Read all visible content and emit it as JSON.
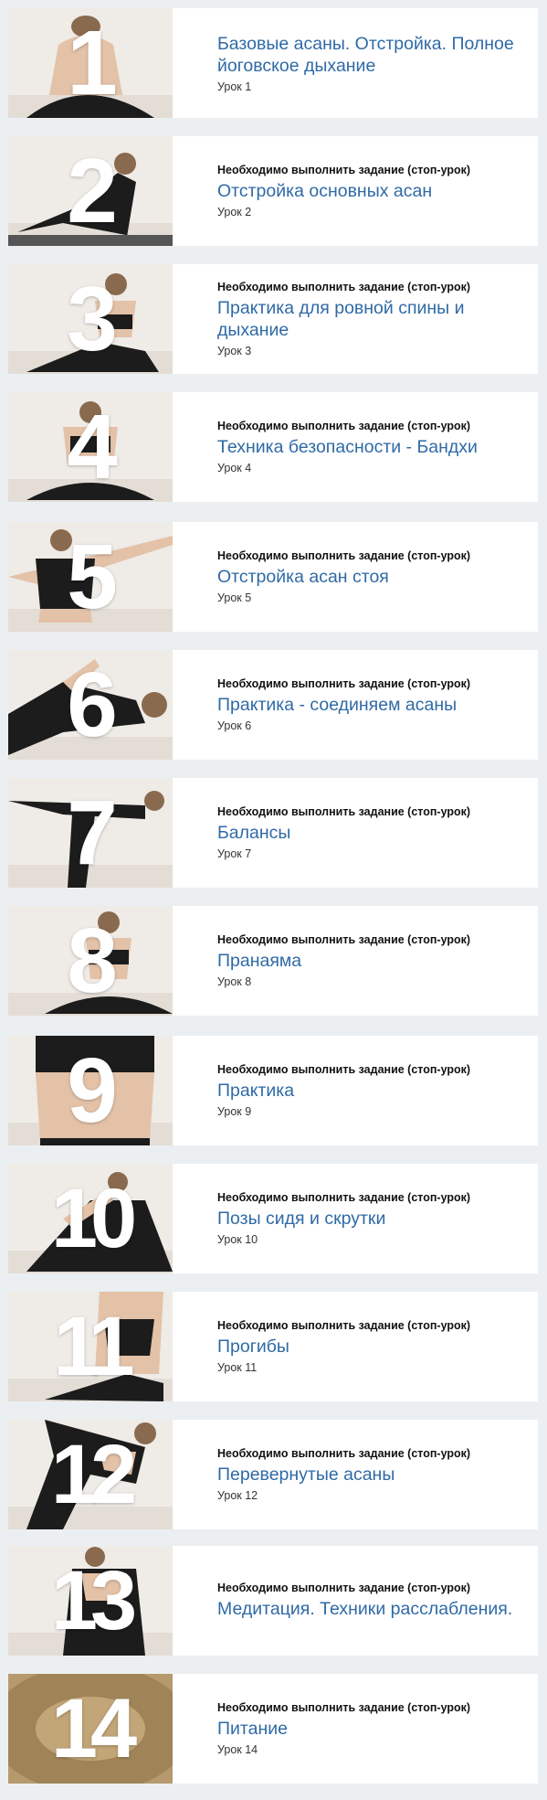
{
  "colors": {
    "page_bg": "#eceff1",
    "card_bg": "#ffffff",
    "title": "#2f6aa6",
    "notice": "#111111",
    "number": "#ffffff"
  },
  "lessons": [
    {
      "number": "1",
      "notice": "",
      "title": "Базовые асаны. Отстройка. Полное йоговское дыхание",
      "subtitle": "Урок 1"
    },
    {
      "number": "2",
      "notice": "Необходимо выполнить задание (стоп-урок)",
      "title": "Отстройка основных асан",
      "subtitle": "Урок 2"
    },
    {
      "number": "3",
      "notice": "Необходимо выполнить задание (стоп-урок)",
      "title": "Практика для ровной спины и дыхание",
      "subtitle": "Урок 3"
    },
    {
      "number": "4",
      "notice": "Необходимо выполнить задание (стоп-урок)",
      "title": "Техника безопасности - Бандхи",
      "subtitle": "Урок 4"
    },
    {
      "number": "5",
      "notice": "Необходимо выполнить задание (стоп-урок)",
      "title": "Отстройка асан стоя",
      "subtitle": "Урок 5"
    },
    {
      "number": "6",
      "notice": "Необходимо выполнить задание (стоп-урок)",
      "title": "Практика - соединяем асаны",
      "subtitle": "Урок 6"
    },
    {
      "number": "7",
      "notice": "Необходимо выполнить задание (стоп-урок)",
      "title": "Балансы",
      "subtitle": "Урок 7"
    },
    {
      "number": "8",
      "notice": "Необходимо выполнить задание (стоп-урок)",
      "title": "Пранаяма",
      "subtitle": "Урок 8"
    },
    {
      "number": "9",
      "notice": "Необходимо выполнить задание (стоп-урок)",
      "title": "Практика",
      "subtitle": "Урок 9"
    },
    {
      "number": "10",
      "notice": "Необходимо выполнить задание (стоп-урок)",
      "title": "Позы сидя и скрутки",
      "subtitle": "Урок 10"
    },
    {
      "number": "11",
      "notice": "Необходимо выполнить задание (стоп-урок)",
      "title": "Прогибы",
      "subtitle": "Урок 11"
    },
    {
      "number": "12",
      "notice": "Необходимо выполнить задание (стоп-урок)",
      "title": "Перевернутые асаны",
      "subtitle": "Урок 12"
    },
    {
      "number": "13",
      "notice": "Необходимо выполнить задание (стоп-урок)",
      "title": "Медитация. Техники расслабления.",
      "subtitle": ""
    },
    {
      "number": "14",
      "notice": "Необходимо выполнить задание (стоп-урок)",
      "title": "Питание",
      "subtitle": "Урок 14"
    }
  ]
}
